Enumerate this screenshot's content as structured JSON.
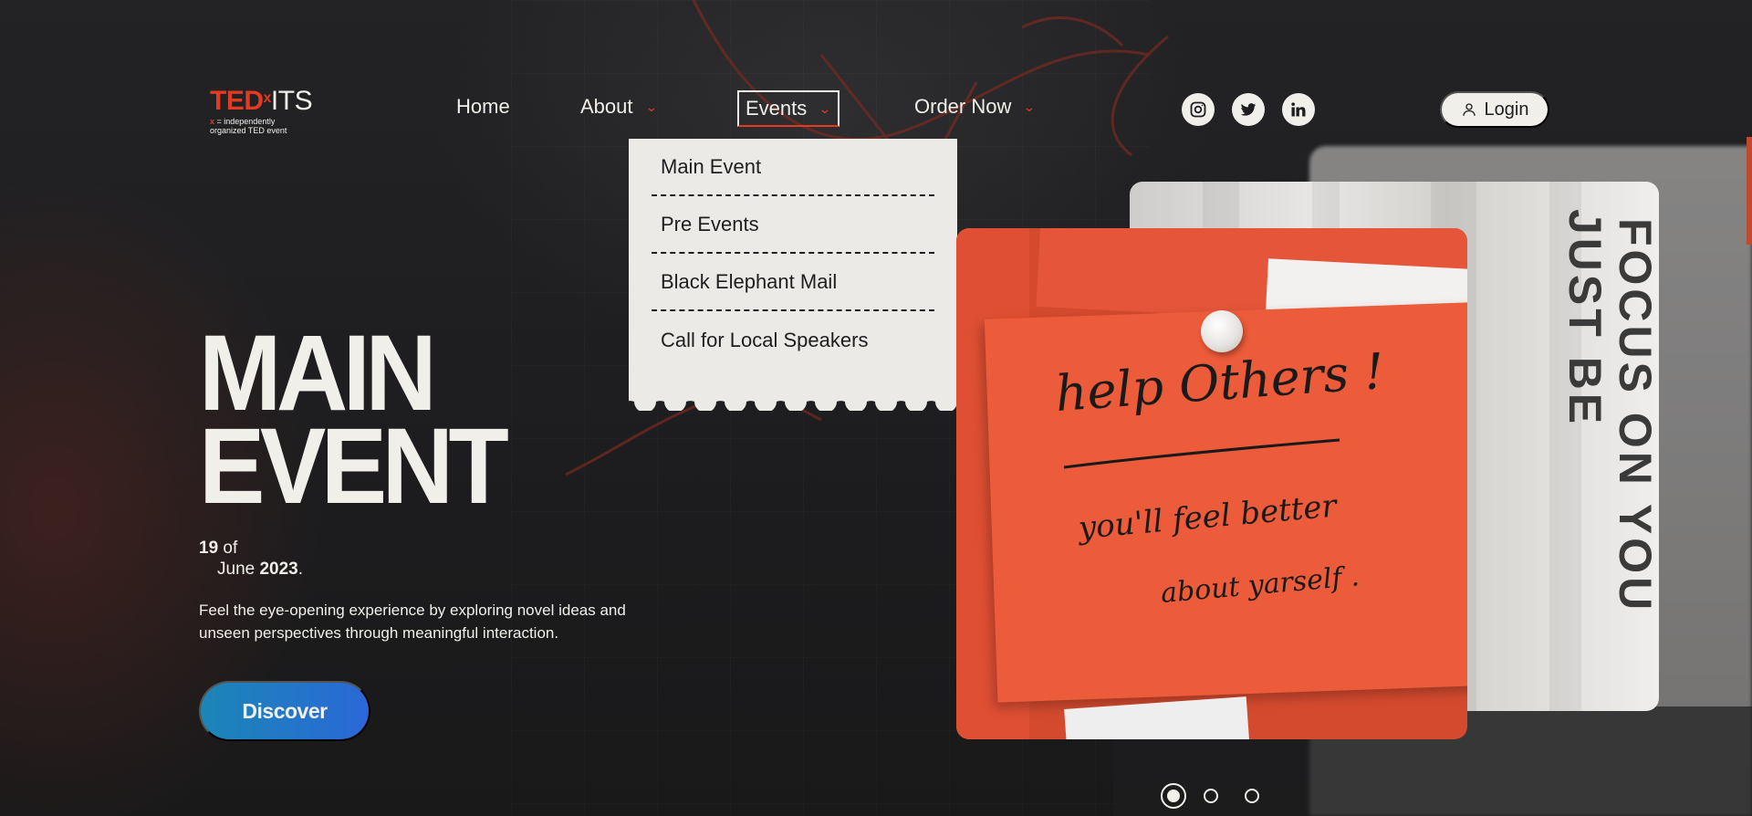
{
  "logo": {
    "brand_ted": "TED",
    "brand_x": "x",
    "brand_its": "ITS",
    "tagline_mark": "x",
    "tagline_line1": " = independently",
    "tagline_line2": "organized TED event"
  },
  "nav": {
    "home": "Home",
    "about": "About",
    "events": "Events",
    "order": "Order Now"
  },
  "social": [
    "instagram-icon",
    "twitter-icon",
    "linkedin-icon"
  ],
  "login_label": "Login",
  "events_dropdown": {
    "items": [
      "Main Event",
      "Pre Events",
      "Black Elephant Mail",
      "Call for Local Speakers"
    ]
  },
  "hero": {
    "title_line1": "MAIN",
    "title_line2": "EVENT",
    "date_day": "19",
    "date_of": " of",
    "date_month": "June ",
    "date_year": "2023",
    "date_period": ".",
    "description": "Feel the eye-opening experience by exploring novel ideas and unseen perspectives through meaningful interaction.",
    "cta": "Discover"
  },
  "image_note": {
    "line1": "help Others !",
    "line2": "you'll feel better",
    "line3": "about yarself ."
  },
  "banner_texts": [
    "JUST BE",
    "FOCUS ON YOU"
  ],
  "carousel": {
    "slide_count": 3,
    "active_slide": 1
  },
  "colors": {
    "accent": "#e23b22",
    "background": "#1e1e20",
    "cream": "#f1efea",
    "cta_start": "#1b86b6",
    "cta_end": "#2a68d8"
  }
}
